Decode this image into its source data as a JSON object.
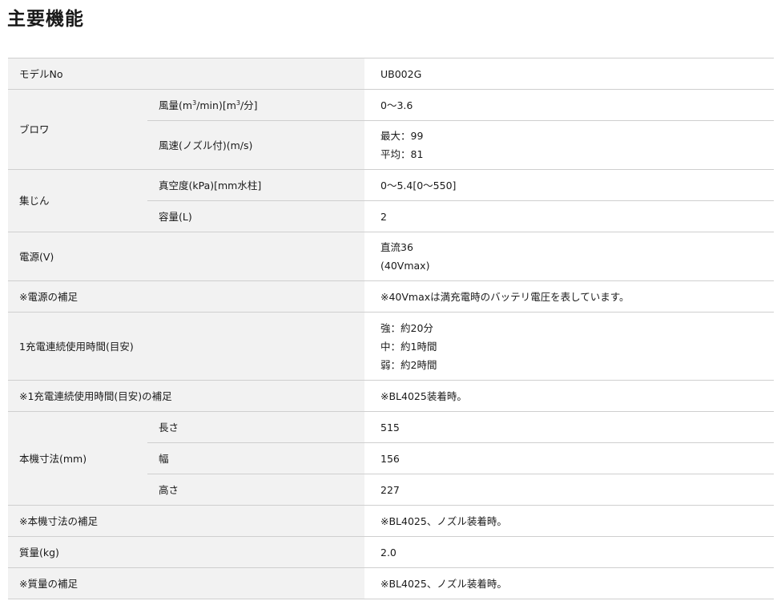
{
  "page": {
    "title": "主要機能"
  },
  "spec_table": {
    "model": {
      "label": "モデルNo",
      "value": "UB002G"
    },
    "blower": {
      "label": "ブロワ",
      "air_volume": {
        "label_pre": "風量(m",
        "sup1": "3",
        "label_mid": "/min)[m",
        "sup2": "3",
        "label_post": "/分]",
        "value": "0〜3.6"
      },
      "air_speed": {
        "label": "風速(ノズル付)(m/s)",
        "value_line1": "最大：99",
        "value_line2": "平均：81"
      }
    },
    "dust": {
      "label": "集じん",
      "vacuum": {
        "label": "真空度(kPa)[mm水柱]",
        "value": "0〜5.4[0〜550]"
      },
      "capacity": {
        "label": "容量(L)",
        "value": "2"
      }
    },
    "voltage": {
      "label": "電源(V)",
      "value_line1": "直流36",
      "value_line2": "(40Vmax)"
    },
    "voltage_note": {
      "label": "※電源の補足",
      "value": "※40Vmaxは満充電時のバッテリ電圧を表しています。"
    },
    "runtime": {
      "label": "1充電連続使用時間(目安)",
      "value_line1": "強：約20分",
      "value_line2": "中：約1時間",
      "value_line3": "弱：約2時間"
    },
    "runtime_note": {
      "label": "※1充電連続使用時間(目安)の補足",
      "value": "※BL4025装着時。"
    },
    "dimensions": {
      "label": "本機寸法(mm)",
      "length": {
        "label": "長さ",
        "value": "515"
      },
      "width": {
        "label": "幅",
        "value": "156"
      },
      "height": {
        "label": "高さ",
        "value": "227"
      }
    },
    "dimensions_note": {
      "label": "※本機寸法の補足",
      "value": "※BL4025、ノズル装着時。"
    },
    "mass": {
      "label": "質量(kg)",
      "value": "2.0"
    },
    "mass_note": {
      "label": "※質量の補足",
      "value": "※BL4025、ノズル装着時。"
    }
  }
}
